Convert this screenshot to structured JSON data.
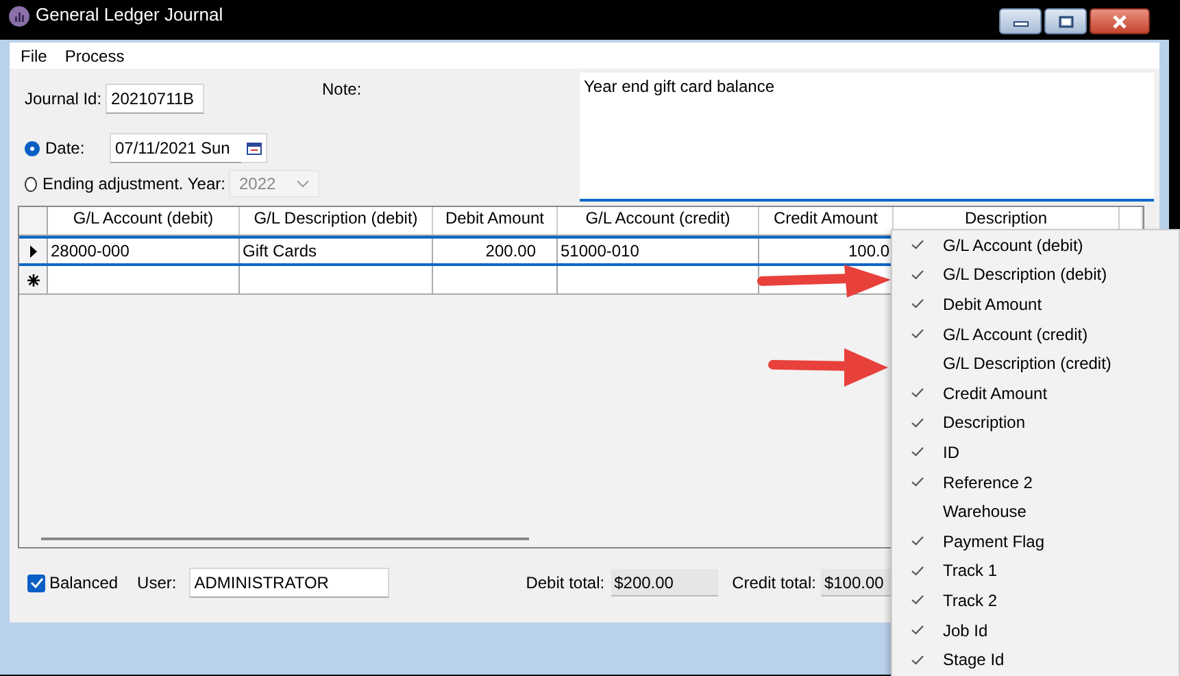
{
  "window": {
    "title": "General Ledger Journal"
  },
  "menu_bar": [
    "File",
    "Process"
  ],
  "journal_id": {
    "label": "Journal Id:",
    "value": "20210711B"
  },
  "note": {
    "label": "Note:",
    "value": "Year end gift card balance"
  },
  "date_options": [
    {
      "label": "Date:",
      "selected": true,
      "kind": "date",
      "value": "07/11/2021 Sun",
      "disabled": false
    },
    {
      "label": "Ending adjustment. Year:",
      "selected": false,
      "kind": "year",
      "value": "2022",
      "disabled": true
    }
  ],
  "grid": {
    "columns": [
      {
        "label": "G/L Account (debit)",
        "kind": "text"
      },
      {
        "label": "G/L Description (debit)",
        "kind": "text"
      },
      {
        "label": "Debit Amount",
        "kind": "amount"
      },
      {
        "label": "G/L Account (credit)",
        "kind": "text"
      },
      {
        "label": "Credit Amount",
        "kind": "amount"
      },
      {
        "label": "Description",
        "kind": "text"
      }
    ],
    "rows": [
      {
        "kind": "current",
        "selected": true,
        "cells": [
          "28000-000",
          "Gift Cards",
          "200.00",
          "51000-010",
          "100.0"
        ]
      },
      {
        "kind": "new",
        "selected": false
      }
    ]
  },
  "footer": {
    "balanced": {
      "label": "Balanced",
      "checked": true
    },
    "user": {
      "label": "User:",
      "value": "ADMINISTRATOR"
    },
    "debit_total": {
      "label": "Debit total:",
      "value": "$200.00"
    },
    "credit_total": {
      "label": "Credit total:",
      "value": "$100.00"
    }
  },
  "context_menu": {
    "items": [
      {
        "label": "G/L Account (debit)",
        "checked": true
      },
      {
        "label": "G/L Description (debit)",
        "checked": true
      },
      {
        "label": "Debit Amount",
        "checked": true
      },
      {
        "label": "G/L Account (credit)",
        "checked": true
      },
      {
        "label": "G/L Description (credit)",
        "checked": false
      },
      {
        "label": "Credit Amount",
        "checked": true
      },
      {
        "label": "Description",
        "checked": true
      },
      {
        "label": "ID",
        "checked": true
      },
      {
        "label": "Reference 2",
        "checked": true
      },
      {
        "label": "Warehouse",
        "checked": false
      },
      {
        "label": "Payment Flag",
        "checked": true
      },
      {
        "label": "Track 1",
        "checked": true
      },
      {
        "label": "Track 2",
        "checked": true
      },
      {
        "label": "Job Id",
        "checked": true
      },
      {
        "label": "Stage Id",
        "checked": true
      }
    ]
  }
}
